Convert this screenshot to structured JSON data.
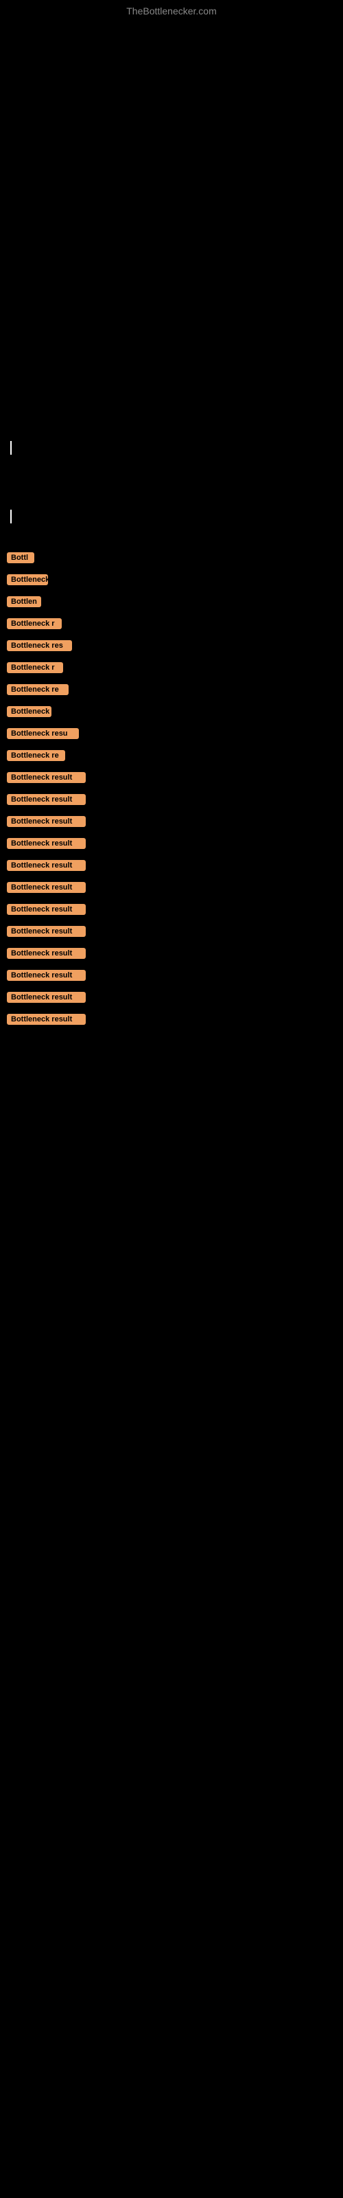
{
  "site": {
    "title": "TheBottlenecker.com"
  },
  "badges": [
    {
      "id": 1,
      "label": "Bottl",
      "width_class": "badge-w1"
    },
    {
      "id": 2,
      "label": "Bottleneck",
      "width_class": "badge-w2"
    },
    {
      "id": 3,
      "label": "Bottlen",
      "width_class": "badge-w3"
    },
    {
      "id": 4,
      "label": "Bottleneck r",
      "width_class": "badge-w4"
    },
    {
      "id": 5,
      "label": "Bottleneck res",
      "width_class": "badge-w5"
    },
    {
      "id": 6,
      "label": "Bottleneck r",
      "width_class": "badge-w6"
    },
    {
      "id": 7,
      "label": "Bottleneck re",
      "width_class": "badge-w7"
    },
    {
      "id": 8,
      "label": "Bottleneck",
      "width_class": "badge-w8"
    },
    {
      "id": 9,
      "label": "Bottleneck resu",
      "width_class": "badge-w9"
    },
    {
      "id": 10,
      "label": "Bottleneck re",
      "width_class": "badge-w10"
    },
    {
      "id": 11,
      "label": "Bottleneck result",
      "width_class": "badge-full"
    },
    {
      "id": 12,
      "label": "Bottleneck result",
      "width_class": "badge-full"
    },
    {
      "id": 13,
      "label": "Bottleneck result",
      "width_class": "badge-full"
    },
    {
      "id": 14,
      "label": "Bottleneck result",
      "width_class": "badge-full"
    },
    {
      "id": 15,
      "label": "Bottleneck result",
      "width_class": "badge-full"
    },
    {
      "id": 16,
      "label": "Bottleneck result",
      "width_class": "badge-full"
    },
    {
      "id": 17,
      "label": "Bottleneck result",
      "width_class": "badge-full"
    },
    {
      "id": 18,
      "label": "Bottleneck result",
      "width_class": "badge-full"
    },
    {
      "id": 19,
      "label": "Bottleneck result",
      "width_class": "badge-full"
    },
    {
      "id": 20,
      "label": "Bottleneck result",
      "width_class": "badge-full"
    },
    {
      "id": 21,
      "label": "Bottleneck result",
      "width_class": "badge-full"
    },
    {
      "id": 22,
      "label": "Bottleneck result",
      "width_class": "badge-full"
    }
  ]
}
